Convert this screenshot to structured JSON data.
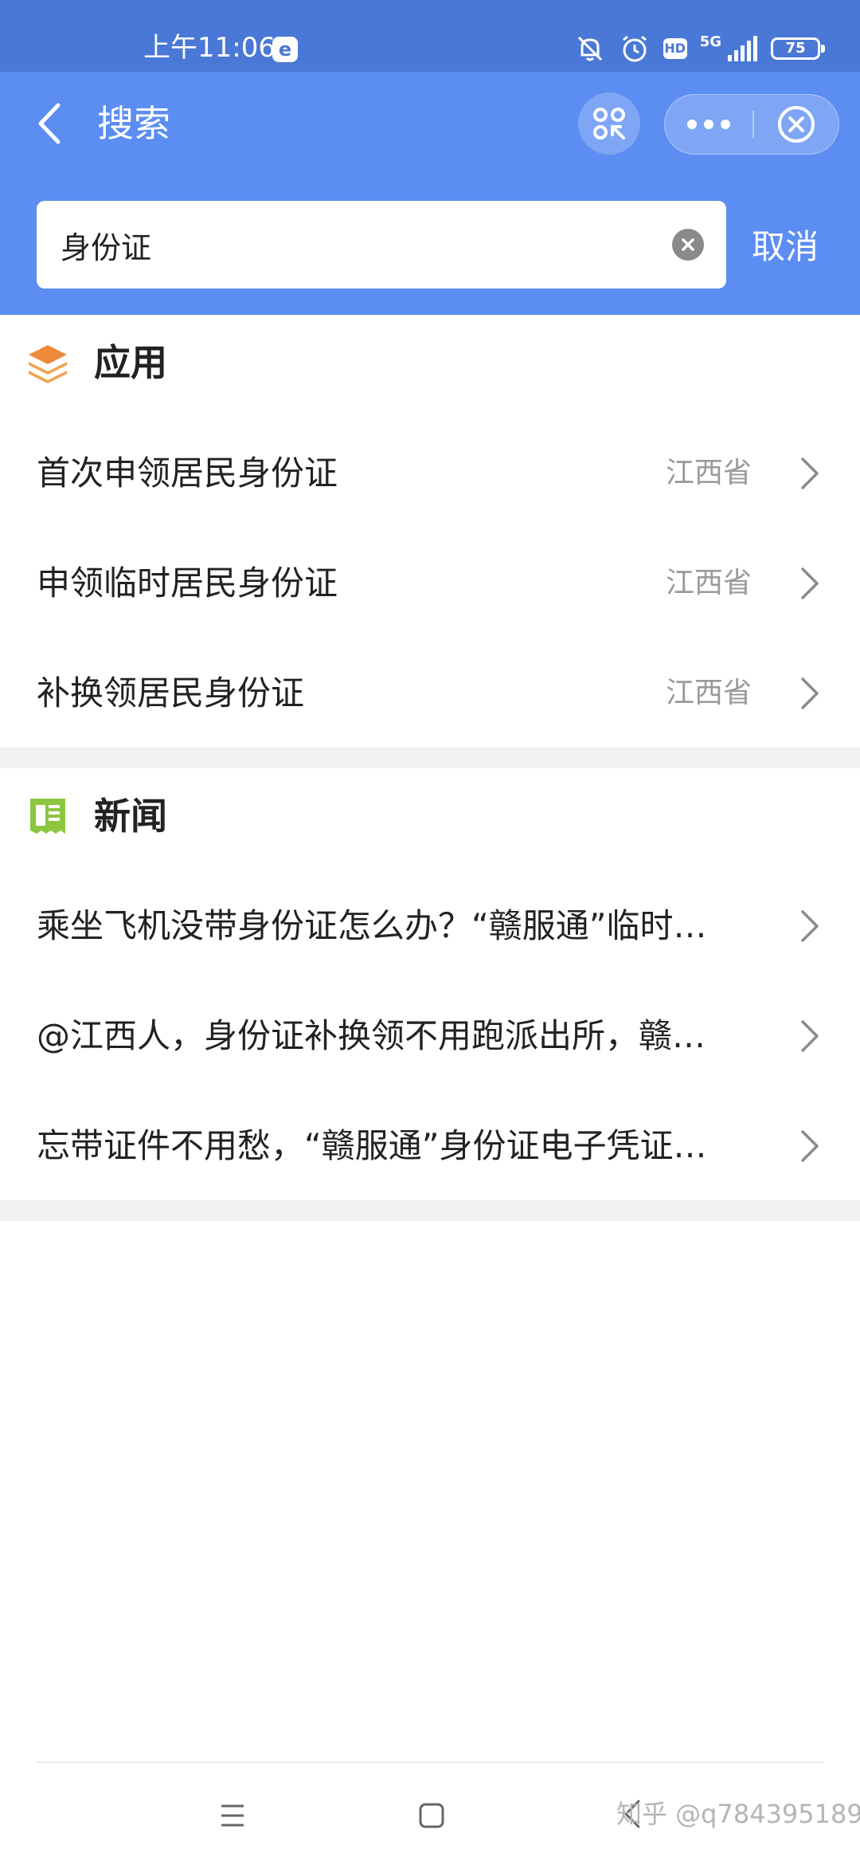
{
  "status_bar": {
    "time": "上午11:06",
    "app_badge": "e",
    "hd": "HD",
    "network": "5G",
    "battery": "75"
  },
  "header": {
    "title": "搜索"
  },
  "search": {
    "value": "身份证",
    "cancel_label": "取消"
  },
  "apps_section": {
    "title": "应用",
    "items": [
      {
        "label": "首次申领居民身份证",
        "region": "江西省"
      },
      {
        "label": "申领临时居民身份证",
        "region": "江西省"
      },
      {
        "label": "补换领居民身份证",
        "region": "江西省"
      }
    ]
  },
  "news_section": {
    "title": "新闻",
    "items": [
      {
        "label": "乘坐飞机没带身份证怎么办？“赣服通”临时…"
      },
      {
        "label": "@江西人，身份证补换领不用跑派出所，赣…"
      },
      {
        "label": "忘带证件不用愁，“赣服通”身份证电子凭证…"
      }
    ]
  },
  "watermark": "知乎 @q784395189",
  "colors": {
    "header": "#5b8df2",
    "status_bar": "#4a78d6",
    "apps_icon": "#ee8a3a",
    "news_icon": "#8cc63f"
  }
}
